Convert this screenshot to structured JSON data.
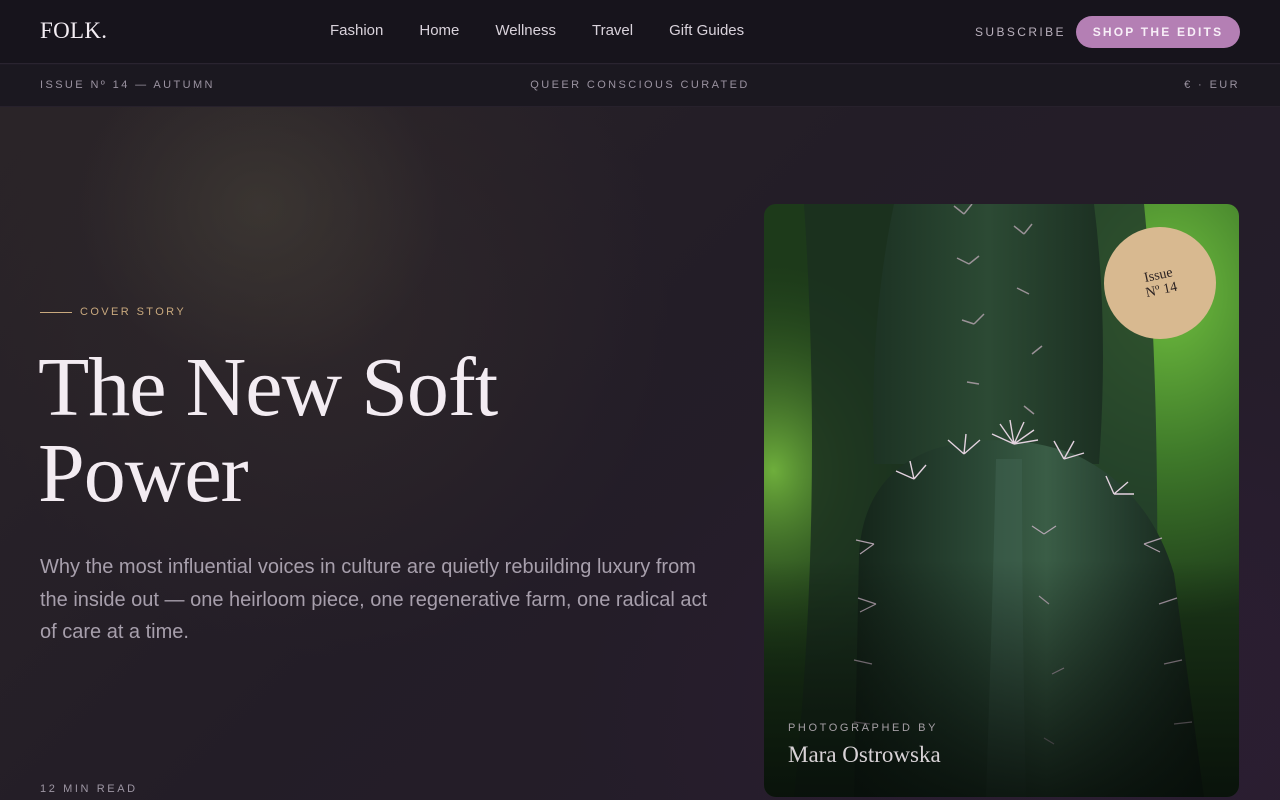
{
  "header": {
    "logo": "FOLK.",
    "nav": [
      "Fashion",
      "Home",
      "Wellness",
      "Travel",
      "Gift Guides"
    ],
    "subscribe": "SUBSCRIBE",
    "shop_cta": "SHOP THE EDITS"
  },
  "subbar": {
    "issue": "ISSUE Nº 14 — AUTUMN",
    "tagline": "QUEER CONSCIOUS CURATED",
    "currency": "€ · EUR"
  },
  "hero": {
    "kicker": "COVER STORY",
    "headline_line1": "The New Soft",
    "headline_line2": "Power",
    "dek": "Why the most influential voices in culture are quietly rebuilding luxury from the inside out — one heirloom piece, one regenerative farm, one radical act of care at a time.",
    "read_time": "12 MIN READ"
  },
  "cover": {
    "badge_line1": "Issue",
    "badge_line2": "Nº 14",
    "credit_label": "PHOTOGRAPHED BY",
    "credit_name": "Mara Ostrowska"
  },
  "colors": {
    "accent": "#b47fb4",
    "kicker": "#c9a97e",
    "badge": "#d8b990",
    "background": "#1e1a24"
  }
}
